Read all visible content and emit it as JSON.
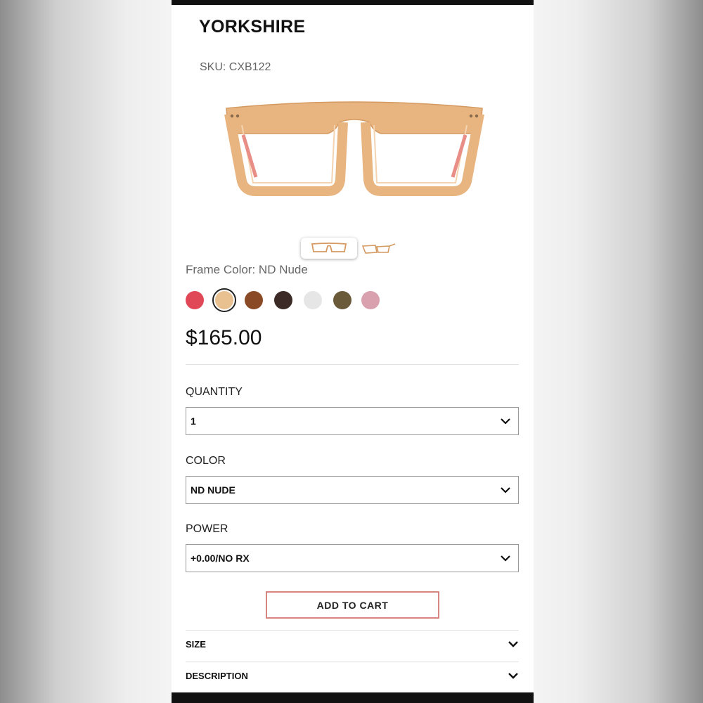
{
  "product": {
    "title": "YORKSHIRE",
    "sku": "SKU: CXB122",
    "frame_color_label": "Frame Color:",
    "frame_color_value": "ND Nude",
    "price": "$165.00"
  },
  "colors": {
    "frame": "#e8b47f",
    "frame_dark": "#d49a62",
    "cart_border": "#d9857f"
  },
  "swatches": [
    {
      "name": "red-pink",
      "color": "#e04757"
    },
    {
      "name": "nude",
      "color": "#e9c08f",
      "selected": true
    },
    {
      "name": "tortoise",
      "color": "#8a4a25"
    },
    {
      "name": "dark-brown",
      "color": "#3b2a26"
    },
    {
      "name": "white",
      "color": "#e6e6e6"
    },
    {
      "name": "black-gold",
      "color": "#6b5a3a"
    },
    {
      "name": "pink-grey",
      "color": "#d9a0ae"
    }
  ],
  "fields": {
    "quantity": {
      "label": "QUANTITY",
      "value": "1"
    },
    "color": {
      "label": "COLOR",
      "value": "ND NUDE"
    },
    "power": {
      "label": "POWER",
      "value": "+0.00/NO RX"
    }
  },
  "actions": {
    "add_to_cart": "ADD TO CART"
  },
  "accordion": {
    "size": "SIZE",
    "description": "DESCRIPTION"
  },
  "icons": {
    "chevron": "chevron-down-icon"
  }
}
